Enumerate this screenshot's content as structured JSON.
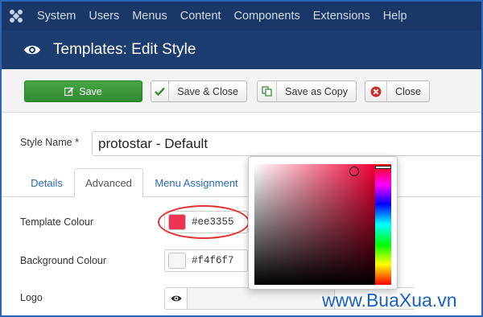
{
  "menubar": {
    "items": [
      "System",
      "Users",
      "Menus",
      "Content",
      "Components",
      "Extensions",
      "Help"
    ]
  },
  "titlebar": {
    "title": "Templates: Edit Style"
  },
  "toolbar": {
    "save_label": "Save",
    "save_close_label": "Save & Close",
    "save_copy_label": "Save as Copy",
    "close_label": "Close"
  },
  "form": {
    "style_name_label": "Style Name *",
    "style_name_value": "protostar - Default"
  },
  "tabs": [
    "Details",
    "Advanced",
    "Menu Assignment"
  ],
  "fields": {
    "template_colour_label": "Template Colour",
    "template_colour_value": "#ee3355",
    "background_colour_label": "Background Colour",
    "background_colour_value": "#f4f6f7",
    "logo_label": "Logo"
  },
  "colors": {
    "template_colour_swatch": "#ee3355",
    "background_colour_swatch": "#f4f6f7",
    "menubar_bg": "#1a3867",
    "save_button": "#3c9a3b"
  },
  "watermark": "www.BuaXua.vn"
}
